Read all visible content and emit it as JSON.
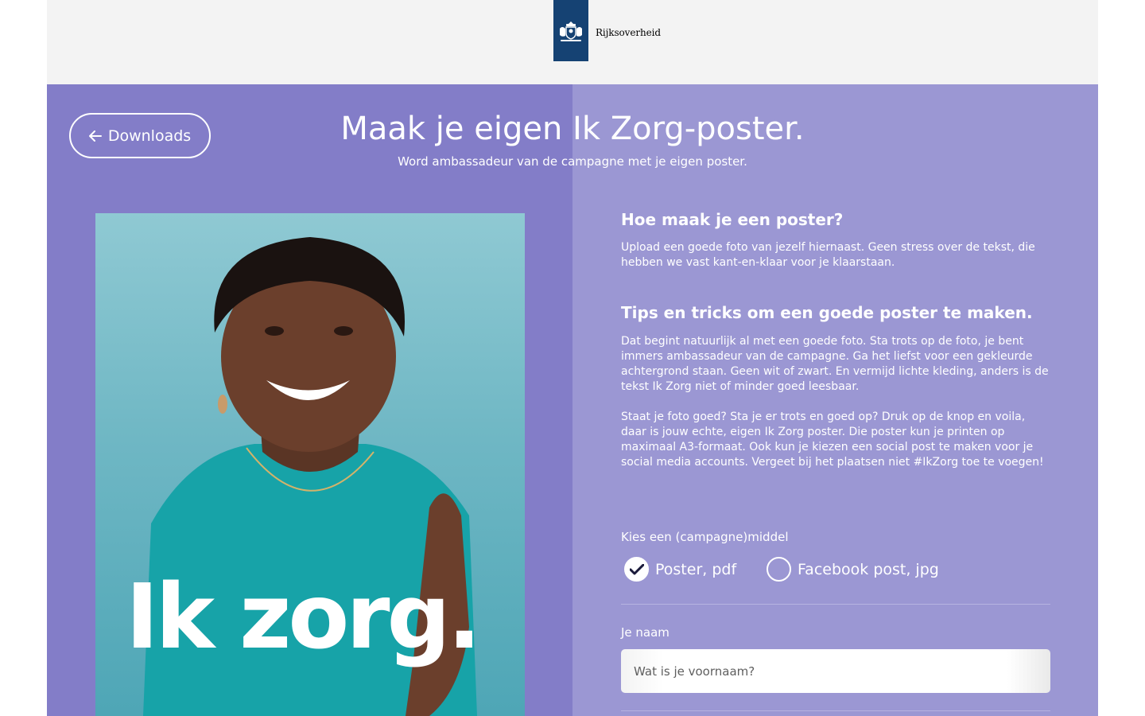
{
  "header": {
    "logo_text": "Rijksoverheid",
    "logo_icon": "coat-of-arms-icon"
  },
  "nav": {
    "back_label": "Downloads",
    "back_icon": "arrow-left-icon"
  },
  "hero": {
    "title": "Maak je eigen Ik Zorg-poster.",
    "subtitle": "Word ambassadeur van de campagne met je eigen poster."
  },
  "poster": {
    "slogan": "Ik zorg."
  },
  "content": {
    "how_title": "Hoe maak je een poster?",
    "how_text": "Upload een goede foto van jezelf hiernaast. Geen stress over de tekst, die hebben we vast kant-en-klaar voor je klaarstaan.",
    "tips_title": "Tips en tricks om een goede poster te maken.",
    "tips_text_1": "Dat begint natuurlijk al met een goede foto. Sta trots op de foto, je bent immers ambassadeur van de campagne. Ga het liefst voor een gekleurde achtergrond staan. Geen wit of zwart. En vermijd lichte kleding, anders is de tekst Ik Zorg niet of minder goed leesbaar.",
    "tips_text_2": "Staat je foto goed? Sta je er trots en goed op? Druk op de knop en voila, daar is jouw echte, eigen Ik Zorg poster. Die poster kun je printen op maximaal A3-formaat. Ook kun je kiezen een social post te maken voor je social media accounts. Vergeet bij het plaatsen niet #IkZorg toe te voegen!"
  },
  "form": {
    "medium_label": "Kies een (campagne)middel",
    "options": [
      {
        "label": "Poster, pdf",
        "checked": true
      },
      {
        "label": "Facebook post, jpg",
        "checked": false
      }
    ],
    "name_label": "Je naam",
    "name_placeholder": "Wat is je voornaam?",
    "name_value": ""
  },
  "colors": {
    "header_bg": "#f3f3f3",
    "logo_blue": "#154273",
    "left_panel": "#837dc8",
    "right_panel": "#9b97d3",
    "poster_teal": "#6fb7c4"
  }
}
